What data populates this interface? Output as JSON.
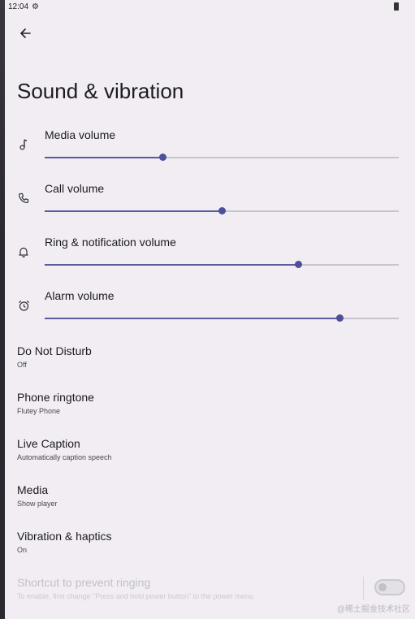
{
  "status_bar": {
    "time": "12:04",
    "settings_icon": "gear-icon",
    "battery_icon": "battery-icon"
  },
  "header": {
    "back_icon": "arrow-back-icon",
    "title": "Sound & vibration"
  },
  "volumes": [
    {
      "label": "Media volume",
      "icon": "music-note-icon",
      "level": 0.333
    },
    {
      "label": "Call volume",
      "icon": "phone-icon",
      "level": 0.5
    },
    {
      "label": "Ring & notification volume",
      "icon": "bell-icon",
      "level": 0.715
    },
    {
      "label": "Alarm volume",
      "icon": "alarm-icon",
      "level": 0.833
    }
  ],
  "settings": [
    {
      "title": "Do Not Disturb",
      "subtitle": "Off"
    },
    {
      "title": "Phone ringtone",
      "subtitle": "Flutey Phone"
    },
    {
      "title": "Live Caption",
      "subtitle": "Automatically caption speech"
    },
    {
      "title": "Media",
      "subtitle": "Show player"
    },
    {
      "title": "Vibration & haptics",
      "subtitle": "On"
    }
  ],
  "shortcut": {
    "title": "Shortcut to prevent ringing",
    "subtitle": "To enable, first change \"Press and hold power button\" to the power menu",
    "enabled": false
  },
  "watermark": "@稀土掘金技术社区",
  "colors": {
    "accent": "#4c4f99",
    "background": "#f1edf3",
    "track": "#c7c3cf"
  }
}
